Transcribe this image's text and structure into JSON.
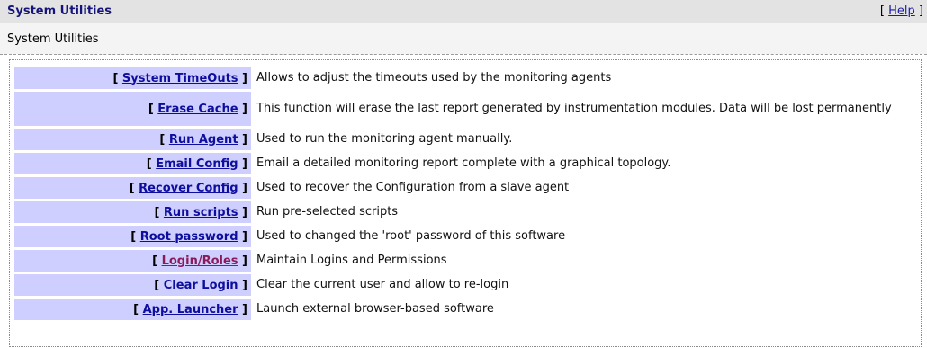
{
  "header": {
    "title": "System Utilities",
    "help_open": "[ ",
    "help_label": "Help",
    "help_close": " ]"
  },
  "subheader": {
    "title": "System Utilities"
  },
  "bracket_open": "[ ",
  "bracket_close": " ]",
  "utilities": [
    {
      "label": "System TimeOuts",
      "description": "Allows to adjust the timeouts used by the monitoring agents"
    },
    {
      "label": "Erase Cache",
      "description": "This function will erase the last report generated by instrumentation modules. Data will be lost permanently"
    },
    {
      "label": "Run Agent",
      "description": "Used to run the monitoring agent manually."
    },
    {
      "label": "Email Config",
      "description": "Email a detailed monitoring report complete with a graphical topology."
    },
    {
      "label": "Recover Config",
      "description": "Used to recover the Configuration from a slave agent"
    },
    {
      "label": "Run scripts",
      "description": "Run pre-selected scripts"
    },
    {
      "label": "Root password",
      "description": "Used to changed the 'root' password of this software"
    },
    {
      "label": "Login/Roles",
      "description": "Maintain Logins and Permissions"
    },
    {
      "label": "Clear Login",
      "description": "Clear the current user and allow to re-login"
    },
    {
      "label": "App. Launcher",
      "description": "Launch external browser-based software"
    }
  ]
}
